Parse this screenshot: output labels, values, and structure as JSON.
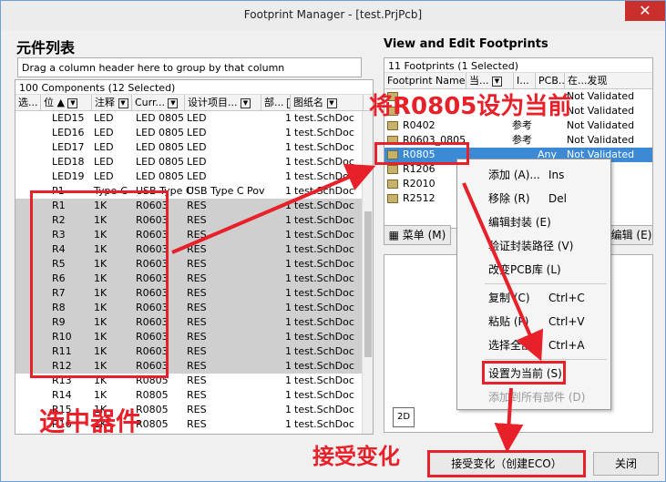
{
  "window": {
    "title": "Footprint Manager - [test.PrjPcb]",
    "close_glyph": "✕"
  },
  "left": {
    "heading": "元件列表",
    "group_hint": "Drag a column header here to group by that column",
    "count_text": "100 Components (12 Selected)",
    "columns": [
      "选...",
      "位",
      "注释",
      "Curr...",
      "设计项目...",
      "部...",
      "图纸名"
    ],
    "rows": [
      {
        "des": "LED15",
        "cmt": "LED",
        "cur": "LED 0805",
        "item": "LED",
        "part": "1",
        "sheet": "test.SchDoc",
        "sel": false
      },
      {
        "des": "LED16",
        "cmt": "LED",
        "cur": "LED 0805",
        "item": "LED",
        "part": "1",
        "sheet": "test.SchDoc",
        "sel": false
      },
      {
        "des": "LED17",
        "cmt": "LED",
        "cur": "LED 0805",
        "item": "LED",
        "part": "1",
        "sheet": "test.SchDoc",
        "sel": false
      },
      {
        "des": "LED18",
        "cmt": "LED",
        "cur": "LED 0805",
        "item": "LED",
        "part": "1",
        "sheet": "test.SchDoc",
        "sel": false
      },
      {
        "des": "LED19",
        "cmt": "LED",
        "cur": "LED 0805",
        "item": "LED",
        "part": "1",
        "sheet": "test.SchDoc",
        "sel": false
      },
      {
        "des": "P1",
        "cmt": "Type-C",
        "cur": "USB Type C",
        "item": "USB Type C Pov",
        "part": "1",
        "sheet": "test.SchDoc",
        "sel": false
      },
      {
        "des": "R1",
        "cmt": "1K",
        "cur": "R0603",
        "item": "RES",
        "part": "1",
        "sheet": "test.SchDoc",
        "sel": true
      },
      {
        "des": "R2",
        "cmt": "1K",
        "cur": "R0603",
        "item": "RES",
        "part": "1",
        "sheet": "test.SchDoc",
        "sel": true
      },
      {
        "des": "R3",
        "cmt": "1K",
        "cur": "R0603",
        "item": "RES",
        "part": "1",
        "sheet": "test.SchDoc",
        "sel": true
      },
      {
        "des": "R4",
        "cmt": "1K",
        "cur": "R0603",
        "item": "RES",
        "part": "1",
        "sheet": "test.SchDoc",
        "sel": true
      },
      {
        "des": "R5",
        "cmt": "1K",
        "cur": "R0603",
        "item": "RES",
        "part": "1",
        "sheet": "test.SchDoc",
        "sel": true
      },
      {
        "des": "R6",
        "cmt": "1K",
        "cur": "R0603",
        "item": "RES",
        "part": "1",
        "sheet": "test.SchDoc",
        "sel": true
      },
      {
        "des": "R7",
        "cmt": "1K",
        "cur": "R0603",
        "item": "RES",
        "part": "1",
        "sheet": "test.SchDoc",
        "sel": true
      },
      {
        "des": "R8",
        "cmt": "1K",
        "cur": "R0603",
        "item": "RES",
        "part": "1",
        "sheet": "test.SchDoc",
        "sel": true
      },
      {
        "des": "R9",
        "cmt": "1K",
        "cur": "R0603",
        "item": "RES",
        "part": "1",
        "sheet": "test.SchDoc",
        "sel": true
      },
      {
        "des": "R10",
        "cmt": "1K",
        "cur": "R0603",
        "item": "RES",
        "part": "1",
        "sheet": "test.SchDoc",
        "sel": true
      },
      {
        "des": "R11",
        "cmt": "1K",
        "cur": "R0603",
        "item": "RES",
        "part": "1",
        "sheet": "test.SchDoc",
        "sel": true
      },
      {
        "des": "R12",
        "cmt": "1K",
        "cur": "R0603",
        "item": "RES",
        "part": "1",
        "sheet": "test.SchDoc",
        "sel": true
      },
      {
        "des": "R13",
        "cmt": "1K",
        "cur": "R0805",
        "item": "RES",
        "part": "1",
        "sheet": "test.SchDoc",
        "sel": false
      },
      {
        "des": "R14",
        "cmt": "1K",
        "cur": "R0805",
        "item": "RES",
        "part": "1",
        "sheet": "test.SchDoc",
        "sel": false
      },
      {
        "des": "R15",
        "cmt": "1K",
        "cur": "R0805",
        "item": "RES",
        "part": "1",
        "sheet": "test.SchDoc",
        "sel": false
      },
      {
        "des": "R16",
        "cmt": "1K",
        "cur": "R0805",
        "item": "RES",
        "part": "1",
        "sheet": "test.SchDoc",
        "sel": false
      }
    ]
  },
  "right": {
    "heading": "View and Edit Footprints",
    "count_text": "11 Footprints (1 Selected)",
    "columns": [
      "Footprint Name",
      "当...",
      "I...",
      "PCB...",
      "在...发现"
    ],
    "rows": [
      {
        "name": "",
        "cur": "",
        "pcb": "",
        "status": "Not Validated",
        "sel": false
      },
      {
        "name": "",
        "cur": "",
        "pcb": "",
        "status": "Not Validated",
        "sel": false
      },
      {
        "name": "R0402",
        "cur": "参考",
        "pcb": "",
        "status": "Not Validated",
        "sel": false
      },
      {
        "name": "R0603_0805",
        "cur": "参考",
        "pcb": "",
        "status": "Not Validated",
        "sel": false
      },
      {
        "name": "R0805",
        "cur": "",
        "pcb": "Any",
        "status": "Not Validated",
        "sel": true
      },
      {
        "name": "R1206",
        "cur": "",
        "pcb": "",
        "status": "",
        "sel": false
      },
      {
        "name": "R2010",
        "cur": "",
        "pcb": "",
        "status": "",
        "sel": false
      },
      {
        "name": "R2512",
        "cur": "",
        "pcb": "",
        "status": "",
        "sel": false
      }
    ],
    "menu_button": "菜单 (M)",
    "edit_button": "编辑 (E)",
    "view_2d": "2D"
  },
  "context_menu": [
    {
      "label": "添加 (A)...",
      "shortcut": "Ins",
      "disabled": false
    },
    {
      "label": "移除 (R)",
      "shortcut": "Del",
      "disabled": false
    },
    {
      "label": "编辑封装 (E)",
      "shortcut": "",
      "disabled": false
    },
    {
      "label": "验证封装路径 (V)",
      "shortcut": "",
      "disabled": false
    },
    {
      "label": "改变PCB库 (L)",
      "shortcut": "",
      "disabled": false
    },
    {
      "label": "复制 (C)",
      "shortcut": "Ctrl+C",
      "disabled": false
    },
    {
      "label": "粘贴 (P)",
      "shortcut": "Ctrl+V",
      "disabled": false
    },
    {
      "label": "选择全部",
      "shortcut": "Ctrl+A",
      "disabled": false
    },
    {
      "label": "设置为当前 (S)",
      "shortcut": "",
      "disabled": false
    },
    {
      "label": "添加到所有部件 (D)",
      "shortcut": "",
      "disabled": true
    }
  ],
  "buttons": {
    "accept": "接受变化（创建ECO）",
    "close": "关闭"
  },
  "annotations": {
    "set_current": "将R0805设为当前",
    "select_parts": "选中器件",
    "accept_changes": "接受变化"
  },
  "colors": {
    "annotation": "#e8202a",
    "selection": "#3c8ad6",
    "row_selected": "#cfcfcf"
  }
}
